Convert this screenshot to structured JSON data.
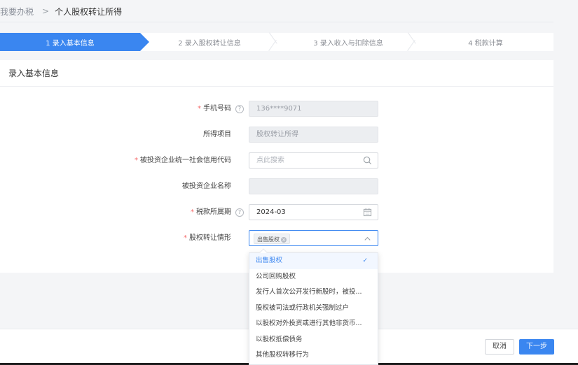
{
  "breadcrumb": {
    "parent": "我要办税",
    "separator": ">",
    "current": "个人股权转让所得"
  },
  "steps": [
    {
      "label": "1  录入基本信息",
      "active": true
    },
    {
      "label": "2  录入股权转让信息",
      "active": false
    },
    {
      "label": "3  录入收入与扣除信息",
      "active": false
    },
    {
      "label": "4  税款计算",
      "active": false
    }
  ],
  "section_title": "录入基本信息",
  "form": {
    "phone": {
      "label": "手机号码",
      "value": "136****9071",
      "required": true
    },
    "income_item": {
      "label": "所得项目",
      "value": "股权转让所得",
      "required": false
    },
    "credit_code": {
      "label": "被投资企业统一社会信用代码",
      "placeholder": "点此搜索",
      "required": true
    },
    "company_name": {
      "label": "被投资企业名称",
      "value": "",
      "required": false
    },
    "tax_period": {
      "label": "税款所属期",
      "value": "2024-03",
      "required": true
    },
    "transfer_situation": {
      "label": "股权转让情形",
      "tag": "出售股权",
      "required": true
    }
  },
  "required_mark": "*",
  "help_mark": "?",
  "dropdown": {
    "options": [
      "出售股权",
      "公司回购股权",
      "发行人首次公开发行新股时，被投...",
      "股权被司法或行政机关强制过户",
      "以股权对外投资或进行其他非货币...",
      "以股权抵偿债务",
      "其他股权转移行为"
    ],
    "selected_index": 0,
    "check_mark": "✓"
  },
  "buttons": {
    "cancel": "取消",
    "next": "下一步"
  },
  "colors": {
    "primary": "#3a86f0",
    "required": "#f56c6c"
  }
}
